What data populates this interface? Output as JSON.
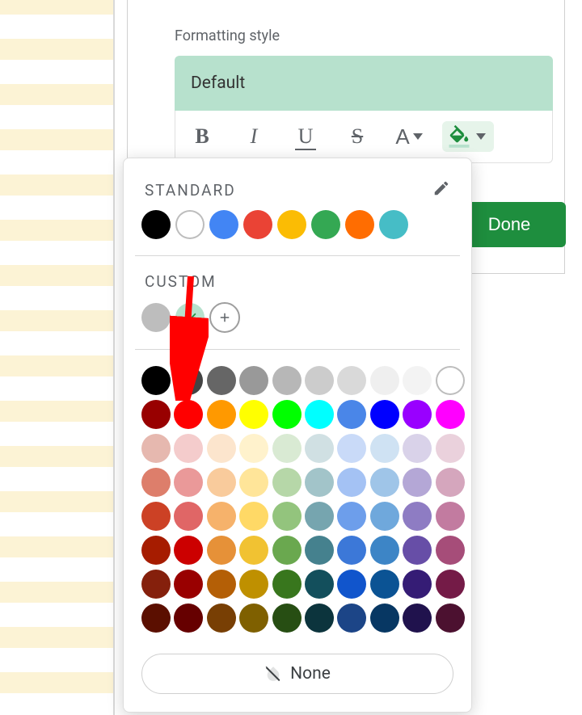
{
  "header": {
    "section_label": "Formatting style",
    "default_name": "Default"
  },
  "toolbar": {
    "bold": "B",
    "italic": "I",
    "underline": "U",
    "strike": "S",
    "textcolor": "A"
  },
  "done_button": "Done",
  "picker": {
    "standard_title": "STANDARD",
    "custom_title": "CUSTOM",
    "none_label": "None",
    "standard_colors": [
      {
        "hex": "#000000"
      },
      {
        "hex": "#ffffff",
        "border": true
      },
      {
        "hex": "#4285f4"
      },
      {
        "hex": "#ea4335"
      },
      {
        "hex": "#fbbc04"
      },
      {
        "hex": "#34a853"
      },
      {
        "hex": "#ff6d01"
      },
      {
        "hex": "#46bdc6"
      }
    ],
    "custom_colors": [
      {
        "hex": "#bdbdbd"
      },
      {
        "hex": "#b7e1cd",
        "selected": true
      }
    ],
    "grid_colors": [
      "#000000",
      "#434343",
      "#666666",
      "#999999",
      "#b7b7b7",
      "#cccccc",
      "#d9d9d9",
      "#efefef",
      "#f3f3f3",
      "#ffffff",
      "#980000",
      "#ff0000",
      "#ff9900",
      "#ffff00",
      "#00ff00",
      "#00ffff",
      "#4a86e8",
      "#0000ff",
      "#9900ff",
      "#ff00ff",
      "#e6b8af",
      "#f4cccc",
      "#fce5cd",
      "#fff2cc",
      "#d9ead3",
      "#d0e0e3",
      "#c9daf8",
      "#cfe2f3",
      "#d9d2e9",
      "#ead1dc",
      "#dd7e6b",
      "#ea9999",
      "#f9cb9c",
      "#ffe599",
      "#b6d7a8",
      "#a2c4c9",
      "#a4c2f4",
      "#9fc5e8",
      "#b4a7d6",
      "#d5a6bd",
      "#cc4125",
      "#e06666",
      "#f6b26b",
      "#ffd966",
      "#93c47d",
      "#76a5af",
      "#6d9eeb",
      "#6fa8dc",
      "#8e7cc3",
      "#c27ba0",
      "#a61c00",
      "#cc0000",
      "#e69138",
      "#f1c232",
      "#6aa84f",
      "#45818e",
      "#3c78d8",
      "#3d85c6",
      "#674ea7",
      "#a64d79",
      "#85200c",
      "#990000",
      "#b45f06",
      "#bf9000",
      "#38761d",
      "#134f5c",
      "#1155cc",
      "#0b5394",
      "#351c75",
      "#741b47",
      "#5b0f00",
      "#660000",
      "#783f04",
      "#7f6000",
      "#274e13",
      "#0c343d",
      "#1c4587",
      "#073763",
      "#20124d",
      "#4c1130"
    ],
    "grid_borders": [
      9
    ]
  }
}
